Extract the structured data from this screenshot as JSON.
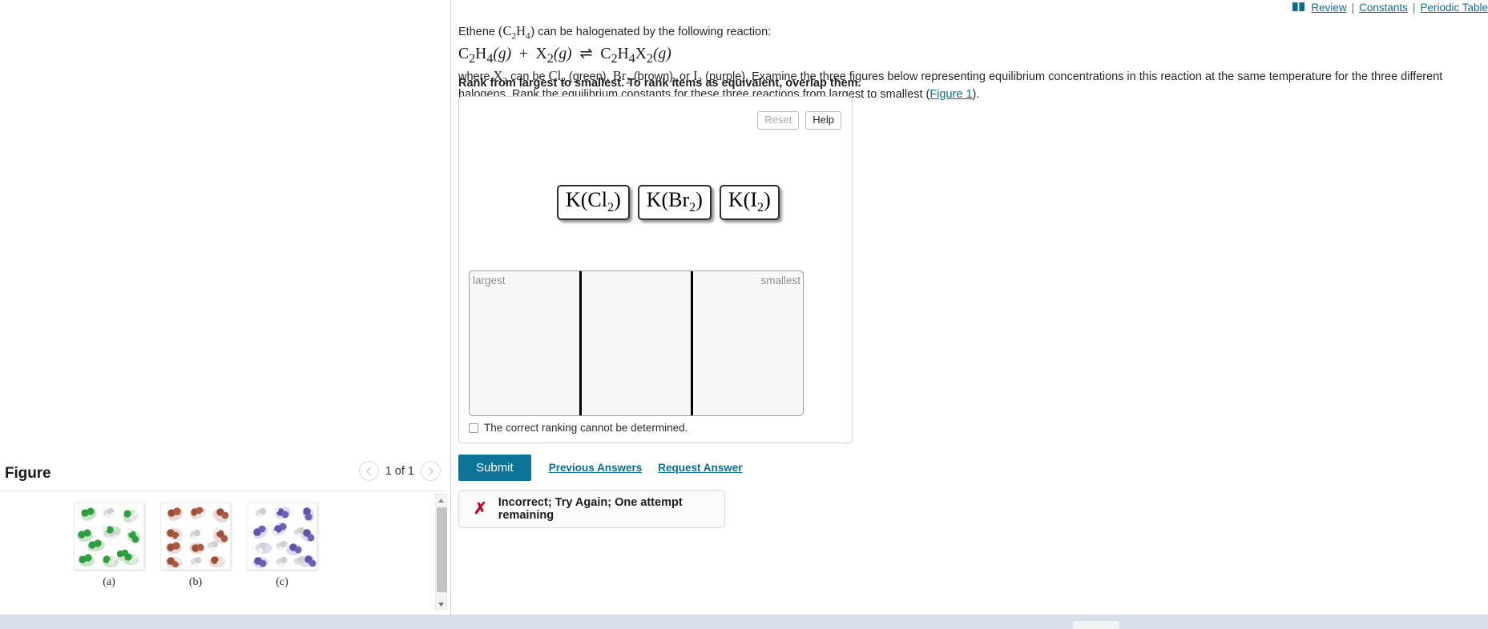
{
  "topnav": {
    "book_icon": "book-icon",
    "review": "Review",
    "sep1": "|",
    "constants": "Constants",
    "sep2": "|",
    "periodic_table": "Periodic Table"
  },
  "question": {
    "intro_a": "Ethene ",
    "intro_formula": "(C2H4)",
    "intro_b": " can be halogenated by the following reaction:",
    "equation": "C2H4(g) + X2(g) ⇌ C2H4X2(g)",
    "eq_lhs1": "C",
    "eq_lhs1_sub": "2",
    "eq_lhs1b": "H",
    "eq_lhs1b_sub": "4",
    "eq_state1": "(g)",
    "eq_plus": "+",
    "eq_x": "X",
    "eq_x_sub": "2",
    "eq_state2": "(g)",
    "eq_arrow": "⇌",
    "eq_rhs": "C",
    "eq_rhs_sub": "2",
    "eq_rhs_b": "H",
    "eq_rhs_b_sub": "4",
    "eq_rhs_c": "X",
    "eq_rhs_c_sub": "2",
    "eq_state3": "(g)",
    "body_1": "where ",
    "body_x2": "X2",
    "body_2": " can be ",
    "body_cl2": "Cl2",
    "body_3": " (green), ",
    "body_br2": "Br2",
    "body_4": " (brown), or ",
    "body_i2": "I2",
    "body_5": " (purple). Examine the three figures below representing equilibrium concentrations in this reaction at the same temperature for the three different halogens. Rank the equilibrium constants for these three reactions from largest to smallest (",
    "figure_link": "Figure 1",
    "body_6": ").",
    "rank_instruction": "Rank from largest to smallest. To rank items as equivalent, overlap them."
  },
  "answer_card": {
    "reset_label": "Reset",
    "help_label": "Help",
    "tiles": [
      {
        "name": "K(Cl2)",
        "base": "K(Cl",
        "sub": "2",
        "tail": ")"
      },
      {
        "name": "K(Br2)",
        "base": "K(Br",
        "sub": "2",
        "tail": ")"
      },
      {
        "name": "K(I2)",
        "base": "K(I",
        "sub": "2",
        "tail": ")"
      }
    ],
    "rank_left_hint": "largest",
    "rank_right_hint": "smallest",
    "cannot_determine_label": "The correct ranking cannot be determined."
  },
  "submit": {
    "submit_label": "Submit",
    "previous_answers": "Previous Answers",
    "request_answer": "Request Answer"
  },
  "feedback": {
    "icon": "x-mark-icon",
    "text": "Incorrect; Try Again; One attempt remaining"
  },
  "figure_panel": {
    "title": "Figure",
    "page_indicator": "1 of 1",
    "prev_icon": "chevron-left-icon",
    "next_icon": "chevron-right-icon",
    "panels": [
      {
        "label": "(a)",
        "halogen": "Cl2",
        "color": "#2f9e3f",
        "description": "green dihalogen, white ethene, and green-white product molecules"
      },
      {
        "label": "(b)",
        "halogen": "Br2",
        "color": "#a4553f",
        "description": "brown dihalogen, white ethene, and brown-white product molecules"
      },
      {
        "label": "(c)",
        "halogen": "I2",
        "color": "#6b61b5",
        "description": "purple dihalogen, white ethene, and purple-white product molecules"
      }
    ],
    "scroll_up_icon": "triangle-up-icon",
    "scroll_down_icon": "triangle-down-icon"
  },
  "colors": {
    "link": "#0b6e8f",
    "submit_bg": "#0b7497",
    "error": "#c00024",
    "divider": "#c8d6e0",
    "bottom_bar": "#d6e0ea"
  }
}
